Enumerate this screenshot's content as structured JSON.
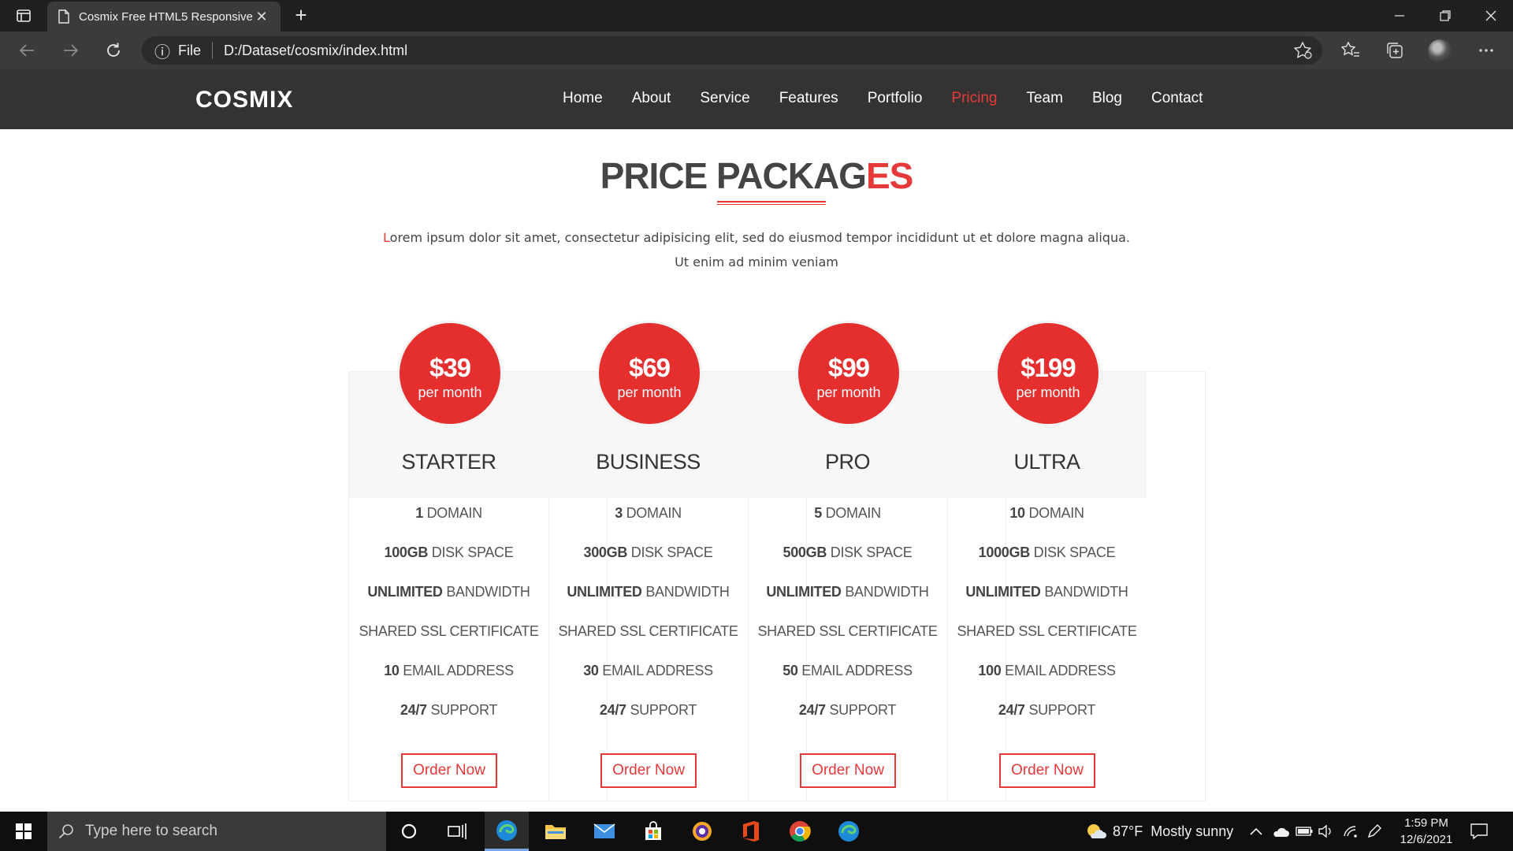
{
  "browser": {
    "tab_title": "Cosmix Free HTML5 Responsive",
    "tab_close": "✕",
    "new_tab": "+",
    "address_scheme": "File",
    "address_url": "D:/Dataset/cosmix/index.html",
    "info_icon": "ⓘ"
  },
  "site": {
    "logo": "COSMIX",
    "nav": [
      {
        "label": "Home",
        "active": false
      },
      {
        "label": "About",
        "active": false
      },
      {
        "label": "Service",
        "active": false
      },
      {
        "label": "Features",
        "active": false
      },
      {
        "label": "Portfolio",
        "active": false
      },
      {
        "label": "Pricing",
        "active": true
      },
      {
        "label": "Team",
        "active": false
      },
      {
        "label": "Blog",
        "active": false
      },
      {
        "label": "Contact",
        "active": false
      }
    ],
    "accent_color": "#e63939"
  },
  "section": {
    "title_main": "PRICE PACKAG",
    "title_accent": "ES",
    "intro_first": "L",
    "intro_line1_rest": "orem ipsum dolor sit amet, consectetur adipisicing elit, sed do eiusmod tempor incididunt ut et dolore magna aliqua.",
    "intro_line2": "Ut enim ad minim veniam"
  },
  "plans": [
    {
      "price": "$39",
      "period": "per month",
      "name": "STARTER",
      "features": [
        {
          "bold": "1",
          "text": " DOMAIN"
        },
        {
          "bold": "100GB",
          "text": " DISK SPACE"
        },
        {
          "bold": "UNLIMITED",
          "text": " BANDWIDTH"
        },
        {
          "bold": "",
          "text": "SHARED SSL CERTIFICATE"
        },
        {
          "bold": "10",
          "text": " EMAIL ADDRESS"
        },
        {
          "bold": "24/7",
          "text": " SUPPORT"
        }
      ],
      "button": "Order Now"
    },
    {
      "price": "$69",
      "period": "per month",
      "name": "BUSINESS",
      "features": [
        {
          "bold": "3",
          "text": " DOMAIN"
        },
        {
          "bold": "300GB",
          "text": " DISK SPACE"
        },
        {
          "bold": "UNLIMITED",
          "text": " BANDWIDTH"
        },
        {
          "bold": "",
          "text": "SHARED SSL CERTIFICATE"
        },
        {
          "bold": "30",
          "text": " EMAIL ADDRESS"
        },
        {
          "bold": "24/7",
          "text": " SUPPORT"
        }
      ],
      "button": "Order Now"
    },
    {
      "price": "$99",
      "period": "per month",
      "name": "PRO",
      "features": [
        {
          "bold": "5",
          "text": " DOMAIN"
        },
        {
          "bold": "500GB",
          "text": " DISK SPACE"
        },
        {
          "bold": "UNLIMITED",
          "text": " BANDWIDTH"
        },
        {
          "bold": "",
          "text": "SHARED SSL CERTIFICATE"
        },
        {
          "bold": "50",
          "text": " EMAIL ADDRESS"
        },
        {
          "bold": "24/7",
          "text": " SUPPORT"
        }
      ],
      "button": "Order Now"
    },
    {
      "price": "$199",
      "period": "per month",
      "name": "ULTRA",
      "features": [
        {
          "bold": "10",
          "text": " DOMAIN"
        },
        {
          "bold": "1000GB",
          "text": " DISK SPACE"
        },
        {
          "bold": "UNLIMITED",
          "text": " BANDWIDTH"
        },
        {
          "bold": "",
          "text": "SHARED SSL CERTIFICATE"
        },
        {
          "bold": "100",
          "text": " EMAIL ADDRESS"
        },
        {
          "bold": "24/7",
          "text": " SUPPORT"
        }
      ],
      "button": "Order Now"
    }
  ],
  "taskbar": {
    "search_placeholder": "Type here to search",
    "weather": "87°F  Mostly sunny",
    "time": "1:59 PM",
    "date": "12/6/2021"
  }
}
